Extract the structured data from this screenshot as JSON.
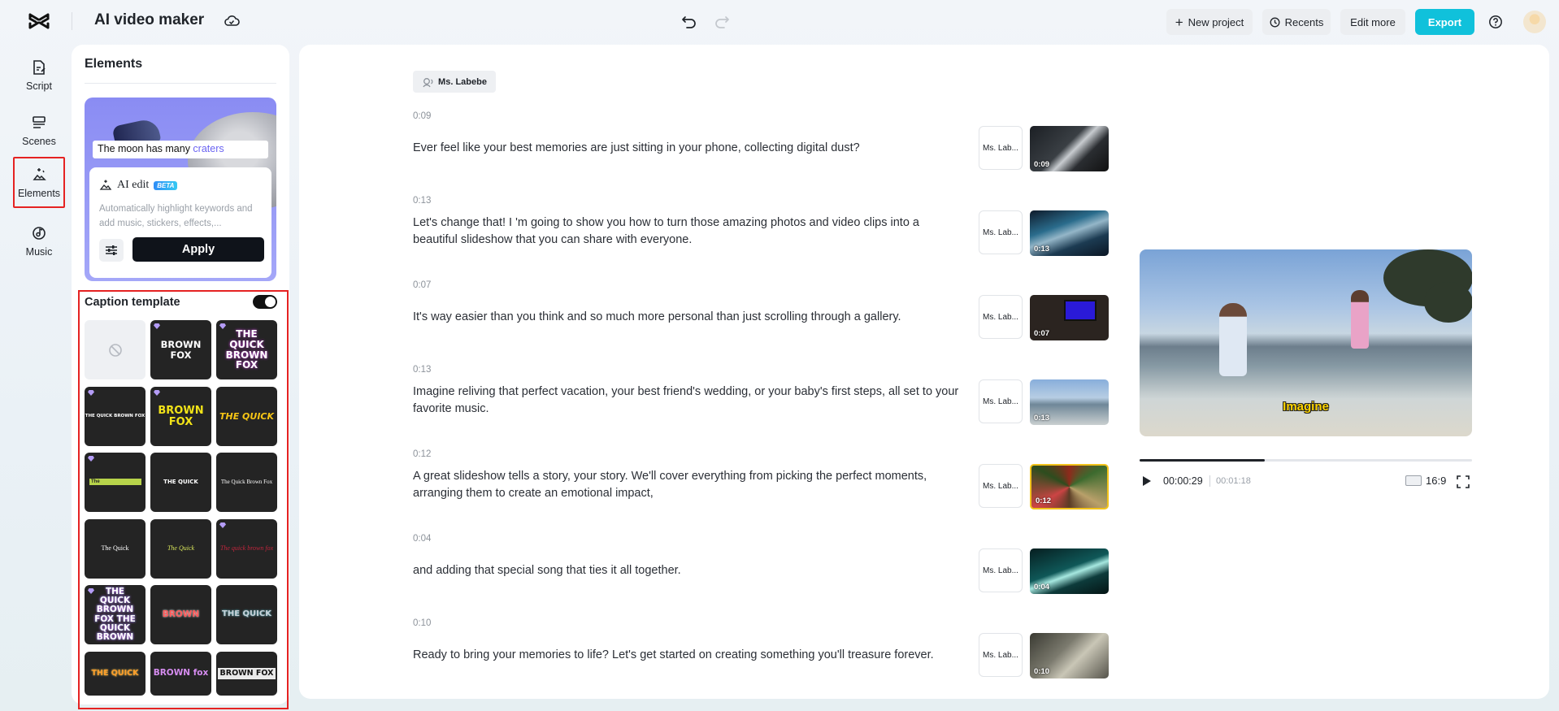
{
  "header": {
    "app_title": "AI video maker",
    "new_project": "New project",
    "recents": "Recents",
    "edit_more": "Edit more",
    "export": "Export"
  },
  "rail": {
    "items": [
      {
        "label": "Script",
        "icon": "script-icon"
      },
      {
        "label": "Scenes",
        "icon": "scenes-icon"
      },
      {
        "label": "Elements",
        "icon": "elements-icon",
        "selected": true
      },
      {
        "label": "Music",
        "icon": "music-icon"
      }
    ]
  },
  "panel": {
    "title": "Elements",
    "ai_card": {
      "preview_text": "The moon has many ",
      "preview_highlight": "craters",
      "ai_edit_label": "AI edit",
      "beta": "BETA",
      "description": "Automatically highlight keywords and add music, stickers, effects,...",
      "apply": "Apply"
    },
    "caption": {
      "title": "Caption template",
      "enabled": true,
      "templates": [
        {
          "text": ""
        },
        {
          "text": "BROWN FOX"
        },
        {
          "text": "THE QUICK BROWN FOX"
        },
        {
          "text": "THE QUICK BROWN FOX"
        },
        {
          "text": "BROWN FOX"
        },
        {
          "text": "THE QUICK"
        },
        {
          "text": "The"
        },
        {
          "text": "THE QUICK"
        },
        {
          "text": "The Quick Brown Fox"
        },
        {
          "text": "The Quick"
        },
        {
          "text": "The Quick"
        },
        {
          "text": "The quick brown fox"
        },
        {
          "text": "THE QUICK BROWN FOX THE QUICK BROWN"
        },
        {
          "text": "BROWN"
        },
        {
          "text": "THE QUICK"
        },
        {
          "text": "THE QUICK"
        },
        {
          "text": "BROWN fox"
        },
        {
          "text": "BROWN FOX"
        }
      ]
    }
  },
  "script": {
    "speaker": "Ms. Labebe",
    "scenes": [
      {
        "time": "0:09",
        "text": "Ever feel like your best memories are just sitting in your phone, collecting digital dust?",
        "voice": "Ms. Lab...",
        "thumb_duration": "0:09"
      },
      {
        "time": "0:13",
        "text": "Let's change that! I 'm going to show you how to turn those amazing photos and video clips into a beautiful slideshow that you can share with everyone.",
        "voice": "Ms. Lab...",
        "thumb_duration": "0:13"
      },
      {
        "time": "0:07",
        "text": "It's way easier than you think and so much more personal than just scrolling through a gallery.",
        "voice": "Ms. Lab...",
        "thumb_duration": "0:07"
      },
      {
        "time": "0:13",
        "text": "Imagine reliving that perfect vacation, your best friend's wedding, or your baby's first steps, all set to your favorite music.",
        "voice": "Ms. Lab...",
        "thumb_duration": "0:13"
      },
      {
        "time": "0:12",
        "text": "A great slideshow tells a story, your story. We'll cover everything from picking the perfect moments, arranging them to create an emotional impact,",
        "voice": "Ms. Lab...",
        "thumb_duration": "0:12"
      },
      {
        "time": "0:04",
        "text": "and adding that special song that ties it all together.",
        "voice": "Ms. Lab...",
        "thumb_duration": "0:04"
      },
      {
        "time": "0:10",
        "text": "Ready to bring your memories to life? Let's get started on creating something you'll treasure forever.",
        "voice": "Ms. Lab...",
        "thumb_duration": "0:10"
      }
    ]
  },
  "preview": {
    "caption": "Imagine",
    "current_time": "00:00:29",
    "total_time": "00:01:18",
    "progress": 0.376,
    "aspect_ratio": "16:9"
  },
  "colors": {
    "accent": "#10c1db",
    "highlight": "#e52222"
  }
}
